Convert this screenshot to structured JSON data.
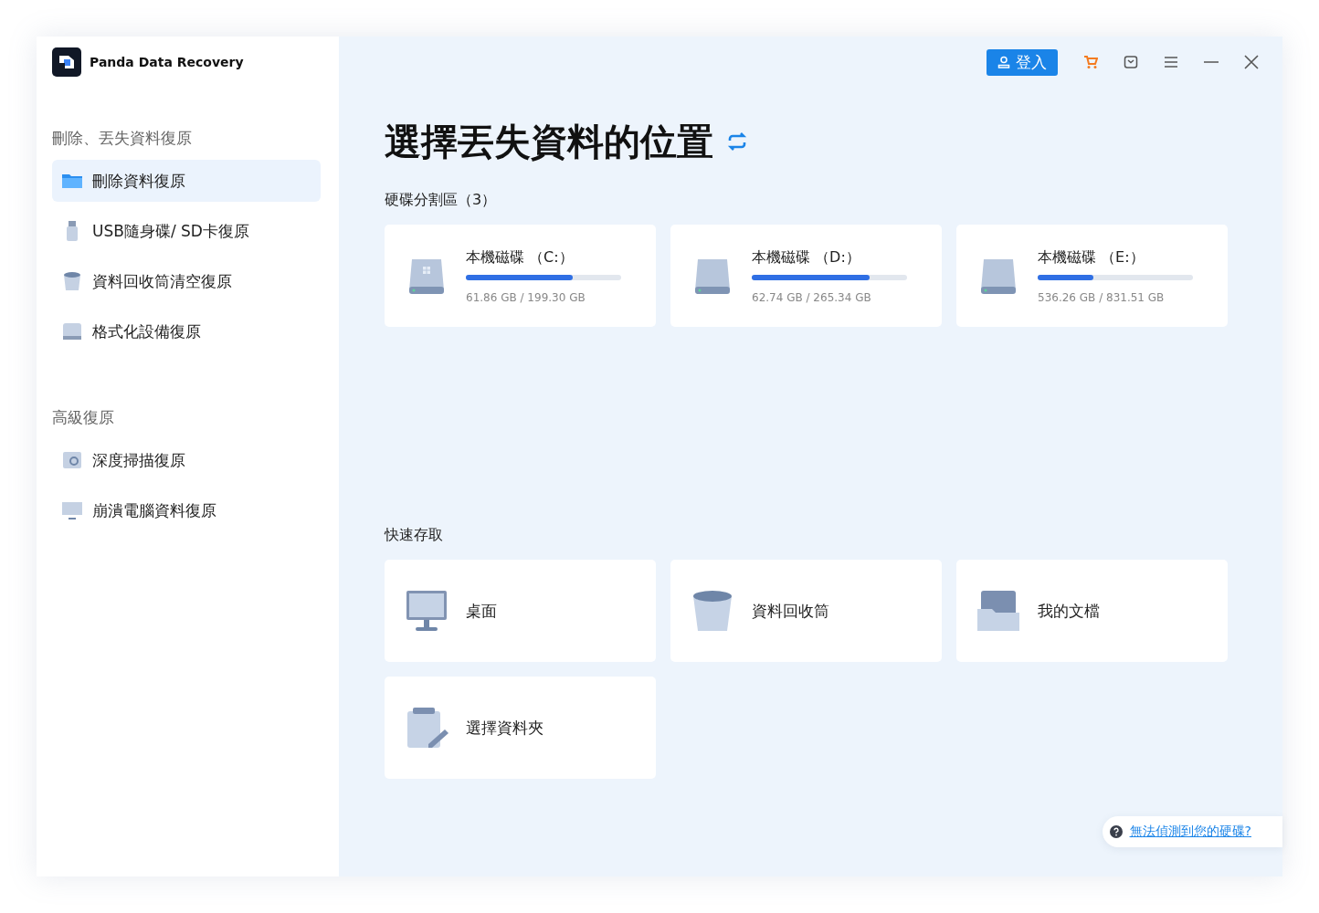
{
  "app": {
    "name": "Panda Data Recovery"
  },
  "sidebar": {
    "sections": [
      {
        "title": "刪除、丟失資料復原",
        "items": [
          {
            "label": "刪除資料復原",
            "kind": "folder",
            "selected": true
          },
          {
            "label": "USB隨身碟/ SD卡復原",
            "kind": "usb",
            "selected": false
          },
          {
            "label": "資料回收筒清空復原",
            "kind": "bin",
            "selected": false
          },
          {
            "label": "格式化設備復原",
            "kind": "drive",
            "selected": false
          }
        ]
      },
      {
        "title": "高級復原",
        "items": [
          {
            "label": "深度掃描復原",
            "kind": "scan",
            "selected": false
          },
          {
            "label": "崩潰電腦資料復原",
            "kind": "monitor",
            "selected": false
          }
        ]
      }
    ]
  },
  "toolbar": {
    "login": "登入"
  },
  "main": {
    "title": "選擇丟失資料的位置",
    "partitions": {
      "heading": "硬碟分割區（3）",
      "drives": [
        {
          "name": "本機磁碟 （C:）",
          "level": 0.69,
          "size": "61.86 GB / 199.30 GB",
          "system": true
        },
        {
          "name": "本機磁碟 （D:）",
          "level": 0.76,
          "size": "62.74 GB / 265.34 GB",
          "system": false
        },
        {
          "name": "本機磁碟 （E:）",
          "level": 0.36,
          "size": "536.26 GB / 831.51 GB",
          "system": false
        }
      ]
    },
    "quick_access": {
      "heading": "快速存取",
      "items": [
        {
          "label": "桌面",
          "kind": "desktop"
        },
        {
          "label": "資料回收筒",
          "kind": "bin"
        },
        {
          "label": "我的文檔",
          "kind": "documents"
        },
        {
          "label": "選擇資料夾",
          "kind": "clipboard"
        }
      ]
    },
    "help_link": "無法偵測到您的硬碟?"
  }
}
